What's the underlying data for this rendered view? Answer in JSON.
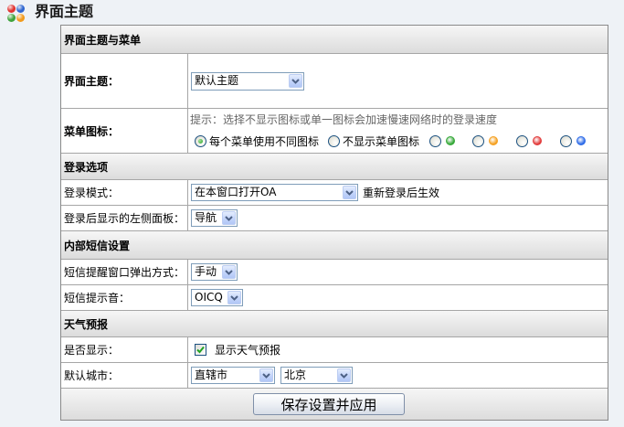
{
  "page": {
    "title": "界面主题",
    "title_icon": "colored-dots-icon",
    "title_icon_colors": [
      "#e0322f",
      "#2f66d0",
      "#3fa33c",
      "#f29a1b"
    ],
    "background": "#eef2f6"
  },
  "theme_menu": {
    "heading": "界面主题与菜单",
    "theme": {
      "label": "界面主题：",
      "selected": "默认主题"
    },
    "menu_icons": {
      "label": "菜单图标：",
      "hint": "提示：选择不显示图标或单一图标会加速慢速网络时的登录速度",
      "options": [
        {
          "label": "每个菜单使用不同图标",
          "checked": true
        },
        {
          "label": "不显示菜单图标",
          "checked": false
        },
        {
          "icon": "green-dot-icon",
          "color": "#35a838",
          "checked": false
        },
        {
          "icon": "orange-dot-icon",
          "color": "#f5a020",
          "checked": false
        },
        {
          "icon": "red-dot-icon",
          "color": "#e23a3a",
          "checked": false
        },
        {
          "icon": "blue-dot-icon",
          "color": "#2d6be8",
          "checked": false
        }
      ]
    }
  },
  "login": {
    "heading": "登录选项",
    "mode": {
      "label": "登录模式：",
      "selected": "在本窗口打开OA",
      "note": "重新登录后生效"
    },
    "left_panel": {
      "label": "登录后显示的左侧面板：",
      "selected": "导航"
    }
  },
  "sms": {
    "heading": "内部短信设置",
    "popup": {
      "label": "短信提醒窗口弹出方式：",
      "selected": "手动"
    },
    "sound": {
      "label": "短信提示音：",
      "selected": "OICQ"
    }
  },
  "weather": {
    "heading": "天气预报",
    "display": {
      "label": "是否显示：",
      "checkbox_label": "显示天气预报",
      "checked": true
    },
    "city": {
      "label": "默认城市：",
      "region": "直辖市",
      "city": "北京"
    }
  },
  "footer": {
    "submit_label": "保存设置并应用"
  },
  "colors": {
    "border": "#a6a6a6",
    "select_border": "#7f9db9",
    "hint_text": "#666666",
    "section_header": "#e3e3e3"
  },
  "icons": {
    "dropdown": "dropdown-arrow-icon",
    "check": "check-icon"
  }
}
